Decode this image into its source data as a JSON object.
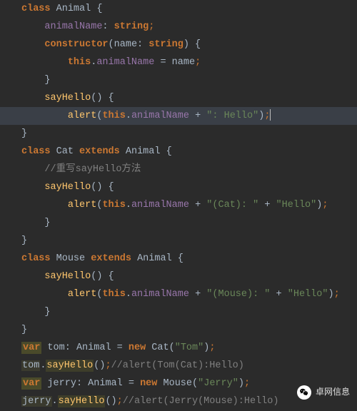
{
  "tokens": {
    "class": "class",
    "extends": "extends",
    "constructor": "constructor",
    "this": "this",
    "var": "var",
    "new": "new",
    "string_type": "string",
    "Animal": "Animal",
    "Cat": "Cat",
    "Mouse": "Mouse",
    "animalName": "animalName",
    "name": "name",
    "sayHello": "sayHello",
    "alert": "alert",
    "tom": "tom",
    "jerry": "jerry"
  },
  "strings": {
    "hello": "\": Hello\"",
    "cat_prefix": "\"(Cat): \"",
    "mouse_prefix": "\"(Mouse): \"",
    "hello2": "\"Hello\"",
    "Tom": "\"Tom\"",
    "Jerry": "\"Jerry\""
  },
  "comments": {
    "override": "//重写sayHello方法",
    "tom_alert": "//alert(Tom(Cat):Hello)",
    "jerry_alert": "//alert(Jerry(Mouse):Hello)"
  },
  "watermark": {
    "label": "卓网信息"
  }
}
